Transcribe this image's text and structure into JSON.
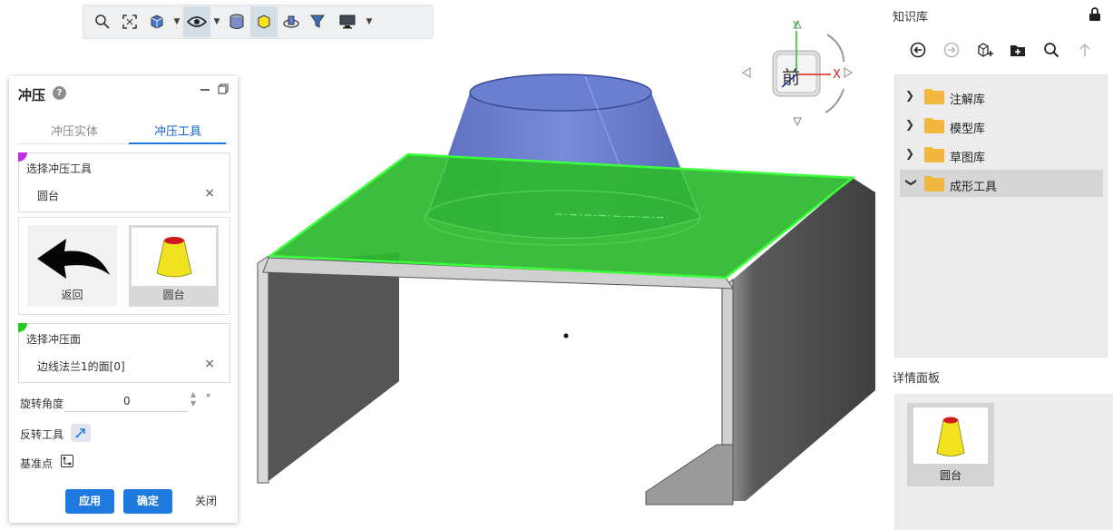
{
  "stamp_panel": {
    "title": "冲压",
    "tabs": [
      "冲压实体",
      "冲压工具"
    ],
    "active_tab": "冲压工具",
    "select_tool": {
      "label": "选择冲压工具",
      "value": "圆台",
      "clear": "×"
    },
    "tool_tiles": [
      {
        "label": "返回"
      },
      {
        "label": "圆台"
      }
    ],
    "select_face": {
      "label": "选择冲压面",
      "value": "边线法兰1的面[0]",
      "clear": "×"
    },
    "rotation": {
      "label": "旋转角度",
      "value": "0",
      "unit": "°"
    },
    "flip_label": "反转工具",
    "base_point_label": "基准点",
    "buttons": {
      "apply": "应用",
      "ok": "确定",
      "close": "关闭"
    }
  },
  "view_cube": {
    "face": "前",
    "x_axis": "X",
    "y_axis": "Y"
  },
  "toolbar": {
    "icons": [
      "zoom-icon",
      "fit-view-icon",
      "cube-view-icon",
      "eye-icon",
      "section-icon",
      "shaded-icon",
      "rotate-icon",
      "filter-icon",
      "display-icon"
    ]
  },
  "knowledge_base": {
    "title": "知识库",
    "tree": [
      {
        "label": "注解库",
        "expanded": false
      },
      {
        "label": "模型库",
        "expanded": false
      },
      {
        "label": "草图库",
        "expanded": false
      },
      {
        "label": "成形工具",
        "expanded": true
      }
    ],
    "detail_title": "详情面板",
    "detail_item": "圆台"
  },
  "colors": {
    "accent": "#1f7ae0",
    "face_green": "#2eb82e",
    "tool_blue": "#5a6fc8",
    "folder": "#f3b63f",
    "purple_marker": "#c12fe0",
    "green_marker": "#22c91f"
  }
}
